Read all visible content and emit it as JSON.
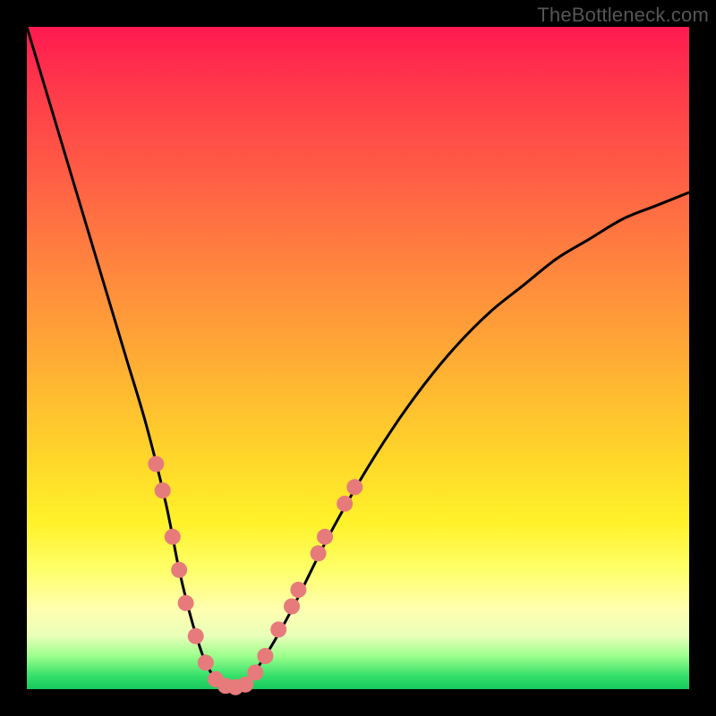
{
  "watermark": "TheBottleneck.com",
  "chart_data": {
    "type": "line",
    "title": "",
    "xlabel": "",
    "ylabel": "",
    "xlim": [
      0,
      100
    ],
    "ylim": [
      0,
      100
    ],
    "grid": false,
    "curve": {
      "name": "bottleneck-curve",
      "x": [
        0,
        3,
        6,
        9,
        12,
        15,
        18,
        21,
        23,
        25,
        27,
        29,
        31,
        33,
        36,
        40,
        45,
        50,
        55,
        60,
        65,
        70,
        75,
        80,
        85,
        90,
        95,
        100
      ],
      "y": [
        100,
        90,
        80,
        70,
        60,
        50,
        40,
        28,
        18,
        10,
        4,
        1,
        0,
        1,
        5,
        12,
        22,
        31,
        39,
        46,
        52,
        57,
        61,
        65,
        68,
        71,
        73,
        75
      ]
    },
    "markers": {
      "name": "dots",
      "color": "#e77b7b",
      "radius": 9,
      "points": [
        {
          "x": 19.5,
          "y": 34
        },
        {
          "x": 20.5,
          "y": 30
        },
        {
          "x": 22.0,
          "y": 23
        },
        {
          "x": 23.0,
          "y": 18
        },
        {
          "x": 24.0,
          "y": 13
        },
        {
          "x": 25.5,
          "y": 8
        },
        {
          "x": 27.0,
          "y": 4
        },
        {
          "x": 28.5,
          "y": 1.5
        },
        {
          "x": 30.0,
          "y": 0.5
        },
        {
          "x": 31.5,
          "y": 0.3
        },
        {
          "x": 33.0,
          "y": 0.7
        },
        {
          "x": 34.5,
          "y": 2.5
        },
        {
          "x": 36.0,
          "y": 5
        },
        {
          "x": 38.0,
          "y": 9
        },
        {
          "x": 40.0,
          "y": 12.5
        },
        {
          "x": 41.0,
          "y": 15
        },
        {
          "x": 44.0,
          "y": 20.5
        },
        {
          "x": 45.0,
          "y": 23
        },
        {
          "x": 48.0,
          "y": 28
        },
        {
          "x": 49.5,
          "y": 30.5
        }
      ]
    }
  }
}
